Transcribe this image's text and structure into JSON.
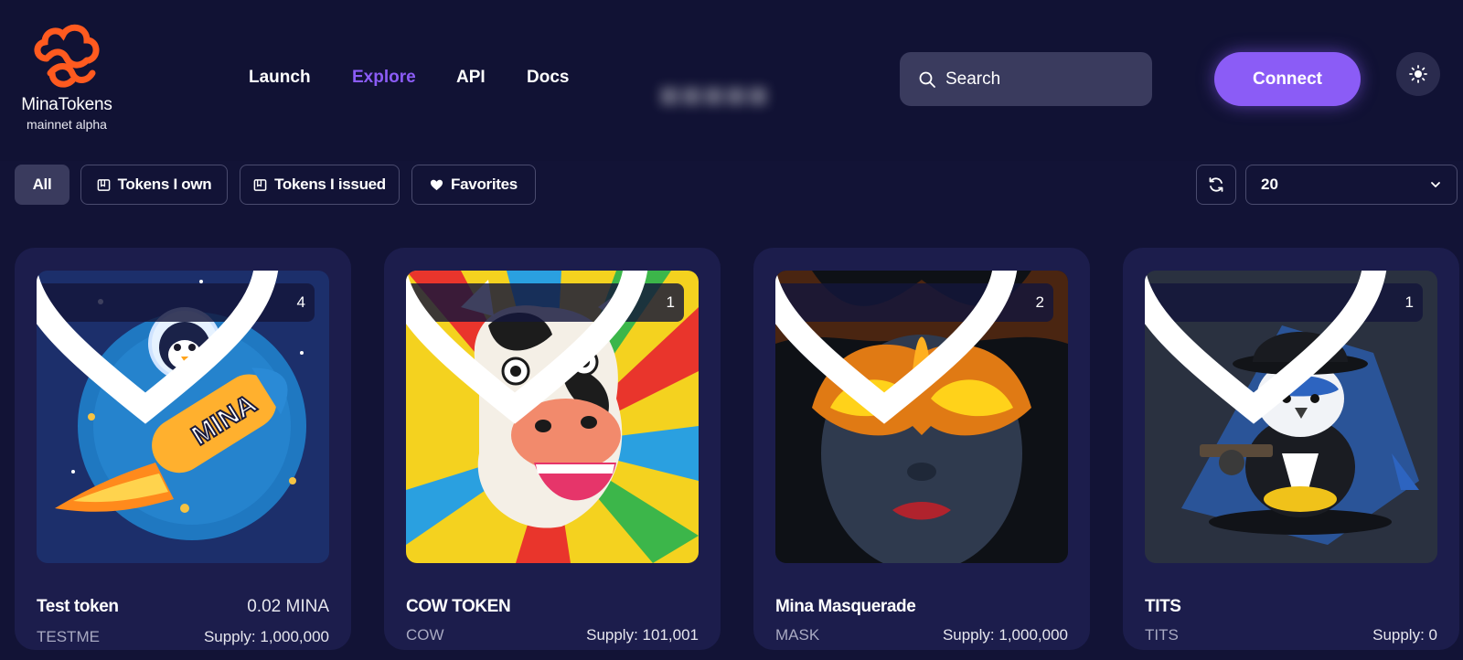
{
  "brand": {
    "name": "MinaTokens",
    "subtitle": "mainnet alpha",
    "accent": "#8b5cf6",
    "logo_color": "#ff5a1f"
  },
  "nav": [
    {
      "label": "Launch",
      "active": false
    },
    {
      "label": "Explore",
      "active": true
    },
    {
      "label": "API",
      "active": false
    },
    {
      "label": "Docs",
      "active": false
    }
  ],
  "search": {
    "placeholder": "Search",
    "icon": "search-icon"
  },
  "connect_label": "Connect",
  "theme_icon": "sun-icon",
  "filters": [
    {
      "label": "All",
      "active": true,
      "icon": ""
    },
    {
      "label": "Tokens I own",
      "active": false,
      "icon": "wallet-icon"
    },
    {
      "label": "Tokens I issued",
      "active": false,
      "icon": "wallet-icon"
    },
    {
      "label": "Favorites",
      "active": false,
      "icon": "heart-icon"
    }
  ],
  "refresh_icon": "refresh-icon",
  "page_size": {
    "value": "20",
    "icon": "chevron-down-icon"
  },
  "tokens": [
    {
      "name": "Test token",
      "price": "0.02 MINA",
      "symbol": "TESTME",
      "supply": "Supply: 1,000,000",
      "likes": "4",
      "image": "penguin-rocket"
    },
    {
      "name": "COW TOKEN",
      "price": "",
      "symbol": "COW",
      "supply": "Supply: 101,001",
      "likes": "1",
      "image": "pop-art-cow"
    },
    {
      "name": "Mina Masquerade",
      "price": "",
      "symbol": "MASK",
      "supply": "Supply: 1,000,000",
      "likes": "2",
      "image": "masquerade-mask"
    },
    {
      "name": "TITS",
      "price": "",
      "symbol": "TITS",
      "supply": "Supply: 0",
      "likes": "1",
      "image": "gangster-bird"
    }
  ]
}
